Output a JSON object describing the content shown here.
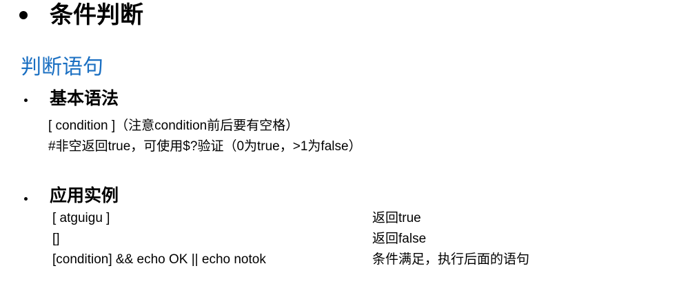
{
  "page": {
    "title": "条件判断",
    "subtitle": "判断语句"
  },
  "section1": {
    "heading": "基本语法",
    "lines": [
      "[ condition ]（注意condition前后要有空格）",
      "#非空返回true，可使用$?验证（0为true，>1为false）"
    ]
  },
  "section2": {
    "heading": "应用实例",
    "rows": [
      {
        "code": "[ atguigu ]",
        "desc": "返回true"
      },
      {
        "code": "[]",
        "desc": "返回false"
      },
      {
        "code": "[condition] && echo OK || echo notok",
        "desc": "条件满足，执行后面的语句"
      }
    ]
  }
}
